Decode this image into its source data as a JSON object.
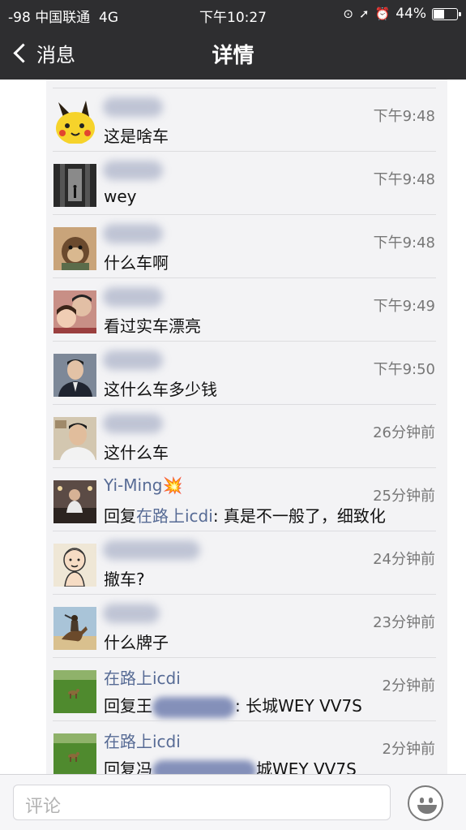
{
  "status_bar": {
    "signal": "-98",
    "carrier": "中国联通",
    "network": "4G",
    "time": "下午10:27",
    "battery": "44%",
    "battery_level": 0.44
  },
  "nav": {
    "back_label": "消息",
    "title": "详情"
  },
  "comments": [
    {
      "name": "",
      "time": "下午9:48",
      "text": "这是啥车"
    },
    {
      "name": "",
      "time": "下午9:48",
      "text": "wey"
    },
    {
      "name": "",
      "time": "下午9:48",
      "text": "什么车啊"
    },
    {
      "name": "",
      "time": "下午9:49",
      "text": "看过实车漂亮"
    },
    {
      "name": "",
      "time": "下午9:50",
      "text": "这什么车多少钱"
    },
    {
      "name": "",
      "time": "26分钟前",
      "text": "这什么车"
    },
    {
      "name": "Yi-Ming💥",
      "time": "25分钟前",
      "reply_prefix": "回复",
      "reply_to": "在路上icdi",
      "text": ": 真是不一般了，细致化"
    },
    {
      "name": "",
      "time": "24分钟前",
      "text": "撤车?"
    },
    {
      "name": "",
      "time": "23分钟前",
      "text": "什么牌子"
    },
    {
      "name": "在路上icdi",
      "time": "2分钟前",
      "reply_prefix": "回复王",
      "text": ": 长城WEY VV7S"
    },
    {
      "name": "在路上icdi",
      "time": "2分钟前",
      "reply_prefix": "回复冯",
      "text": "城WEY VV7S"
    }
  ],
  "input": {
    "placeholder": "评论"
  },
  "icons": {
    "back": "chevron-left-icon",
    "emoji": "smiley-icon"
  }
}
